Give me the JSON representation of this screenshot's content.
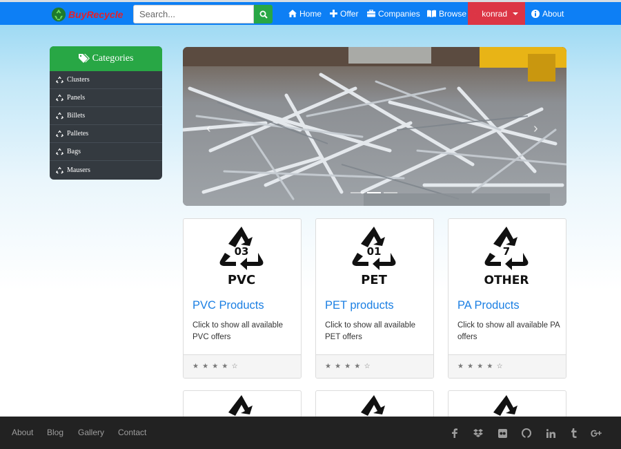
{
  "brand": {
    "name": "BuyRecycle",
    "logo": "recycle-icon"
  },
  "search": {
    "placeholder": "Search...",
    "button_icon": "search-icon"
  },
  "nav": {
    "home": "Home",
    "offer": "Offer",
    "companies": "Companies",
    "browse": "Browse",
    "user": "konrad",
    "about": "About"
  },
  "sidebar": {
    "title": "Categories",
    "items": [
      {
        "label": "Clusters",
        "icon": "recycle-icon"
      },
      {
        "label": "Panels",
        "icon": "recycle-icon"
      },
      {
        "label": "Billets",
        "icon": "recycle-icon"
      },
      {
        "label": "Palletes",
        "icon": "recycle-icon"
      },
      {
        "label": "Bags",
        "icon": "recycle-icon"
      },
      {
        "label": "Mausers",
        "icon": "recycle-icon"
      }
    ]
  },
  "carousel": {
    "image": "scrap-pvc-profiles-photo",
    "slides": 3,
    "active_slide": 2
  },
  "cards": [
    {
      "code": "03",
      "abbr": "PVC",
      "title": "PVC Products",
      "text": "Click to show all available PVC offers",
      "rating": "★ ★ ★ ★ ☆"
    },
    {
      "code": "01",
      "abbr": "PET",
      "title": "PET products",
      "text": "Click to show all available PET offers",
      "rating": "★ ★ ★ ★ ☆"
    },
    {
      "code": "7",
      "abbr": "OTHER",
      "title": "PA Products",
      "text": "Click to show all available PA offers",
      "rating": "★ ★ ★ ★ ☆"
    }
  ],
  "footer": {
    "links": [
      "About",
      "Blog",
      "Gallery",
      "Contact"
    ],
    "social": [
      "facebook-icon",
      "dropbox-icon",
      "flickr-icon",
      "github-icon",
      "linkedin-icon",
      "tumblr-icon",
      "google-plus-icon"
    ]
  },
  "colors": {
    "navbar": "#0d7ff5",
    "brand_text": "#e3202b",
    "accent_green": "#28a745",
    "user_red": "#dc3545",
    "link_blue": "#1b7fe3",
    "sidebar_bg": "#343a40",
    "footer_bg": "#222222"
  }
}
